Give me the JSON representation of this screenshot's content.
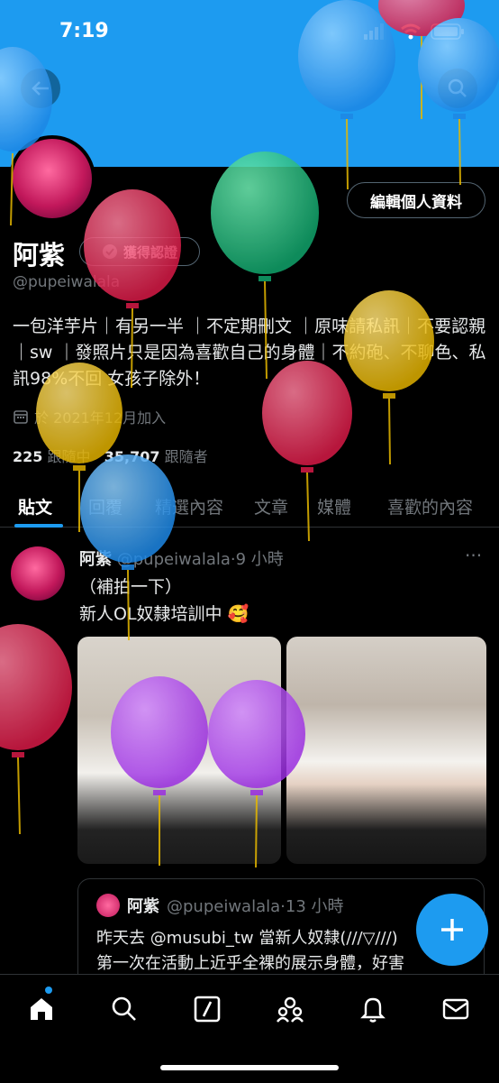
{
  "status_bar": {
    "time": "7:19"
  },
  "profile": {
    "name": "阿紫",
    "verify_label": "獲得認證",
    "handle": "@pupeiwalala",
    "edit_label": "編輯個人資料",
    "bio": "一包洋芋片｜有另一半 ｜不定期刪文 ｜原味請私訊｜不要認親｜sw ｜發照片只是因為喜歡自己的身體｜不約砲、不聊色、私訊98%不回 女孩子除外！",
    "joined": "於 2021年12月加入",
    "following_count": "225",
    "following_label": "跟隨中",
    "followers_count": "35,707",
    "followers_label": "跟隨者"
  },
  "tabs": [
    "貼文",
    "回覆",
    "精選內容",
    "文章",
    "媒體",
    "喜歡的內容"
  ],
  "post": {
    "name": "阿紫",
    "handle_time": "@pupeiwalala·9 小時",
    "more": "···",
    "line1": "（補拍一下）",
    "line2": "新人OL奴隸培訓中 🥰"
  },
  "quote": {
    "name": "阿紫",
    "handle_time": "@pupeiwalala·13 小時",
    "line1": "昨天去 @musubi_tw 當新人奴隸(///▽///)",
    "line2": "第一次在活動上近乎全裸的展示身體，好害"
  },
  "icons": {
    "back": "back-arrow-icon",
    "search": "search-icon",
    "verified": "verified-badge-icon",
    "calendar": "calendar-icon",
    "compose": "plus-icon",
    "nav": [
      "home-icon",
      "search-icon",
      "grok-icon",
      "communities-icon",
      "notifications-icon",
      "messages-icon"
    ]
  },
  "colors": {
    "accent": "#1d9bf0",
    "banner": "#1d9bf0",
    "background": "#000000"
  }
}
